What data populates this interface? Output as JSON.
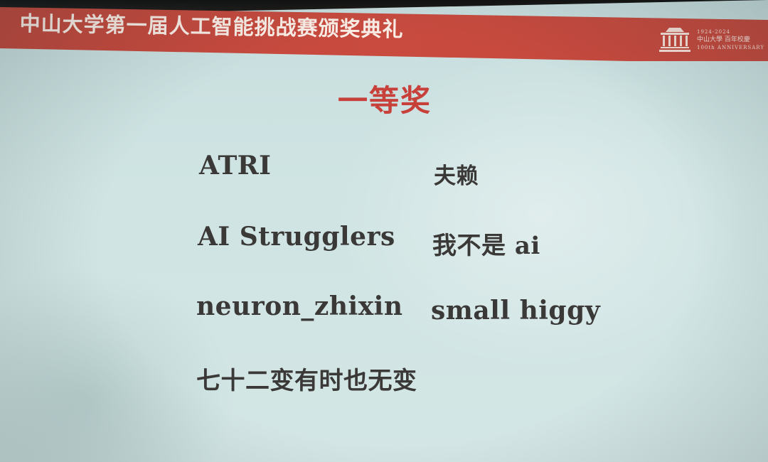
{
  "banner": {
    "title": "中山大学第一届人工智能挑战赛颁奖典礼",
    "logo": {
      "years": "1924-2024",
      "name": "中山大學 百年校慶",
      "subtitle": "100th ANNIVERSARY"
    },
    "color": "#c94b3f"
  },
  "slide": {
    "heading": "一等奖",
    "heading_color": "#c8403a",
    "teams": [
      "ATRI",
      "夫赖",
      "AI Strugglers",
      "我不是 ai",
      "neuron_zhixin",
      "small higgy",
      "七十二变有时也无变"
    ]
  }
}
